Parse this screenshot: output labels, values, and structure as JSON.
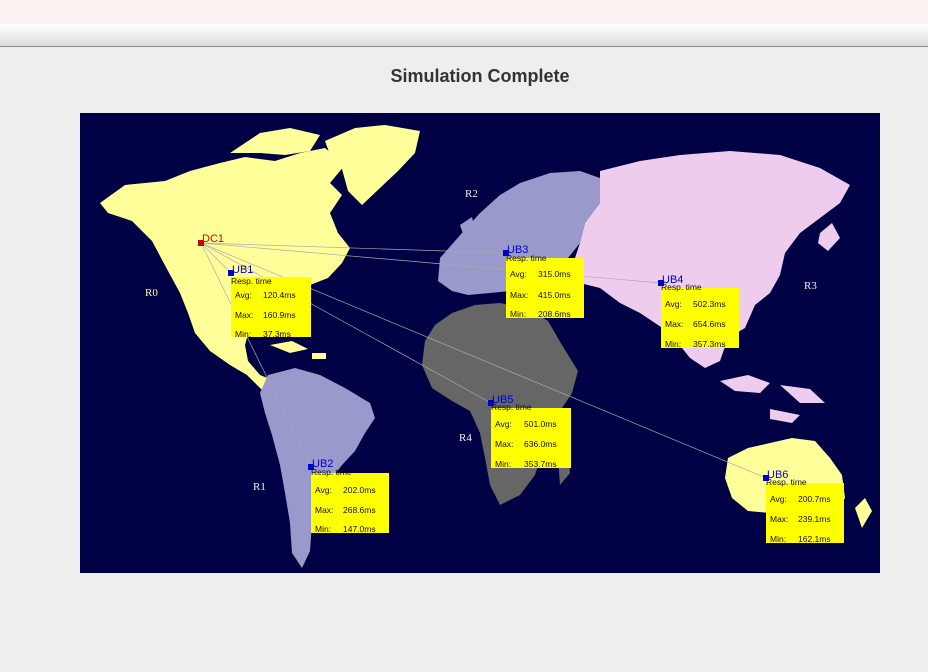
{
  "header": {
    "title": "Simulation Complete"
  },
  "colors": {
    "ocean": "#000044",
    "north_america": "#ffff99",
    "south_america": "#9999cc",
    "europe": "#9999cc",
    "asia": "#eeccee",
    "africa": "#666666",
    "australia": "#ffff99",
    "greenland": "#ffff99",
    "stats_box": "#ffff00",
    "ub_label": "#0000cc",
    "dc_label": "#cc0000"
  },
  "regions": [
    {
      "label": "R0",
      "color": "#ffff99"
    },
    {
      "label": "R1",
      "color": "#eeeeee"
    },
    {
      "label": "R2",
      "color": "#eeeeee"
    },
    {
      "label": "R3",
      "color": "#eeeeee"
    },
    {
      "label": "R4",
      "color": "#eeeeee"
    }
  ],
  "datacenter": {
    "label": "DC1"
  },
  "userbases": [
    {
      "label": "UB1",
      "resp": "Resp. time",
      "avg_label": "Avg:",
      "avg": "120.4ms",
      "max_label": "Max:",
      "max": "160.9ms",
      "min_label": "Min:",
      "min": "37.3ms"
    },
    {
      "label": "UB2",
      "resp": "Resp. time",
      "avg_label": "Avg:",
      "avg": "202.0ms",
      "max_label": "Max:",
      "max": "268.6ms",
      "min_label": "Min:",
      "min": "147.0ms"
    },
    {
      "label": "UB3",
      "resp": "Resp. time",
      "avg_label": "Avg:",
      "avg": "315.0ms",
      "max_label": "Max:",
      "max": "415.0ms",
      "min_label": "Min:",
      "min": "208.6ms"
    },
    {
      "label": "UB4",
      "resp": "Resp. time",
      "avg_label": "Avg:",
      "avg": "502.3ms",
      "max_label": "Max:",
      "max": "654.6ms",
      "min_label": "Min:",
      "min": "357.3ms"
    },
    {
      "label": "UB5",
      "resp": "Resp. time",
      "avg_label": "Avg:",
      "avg": "501.0ms",
      "max_label": "Max:",
      "max": "636.0ms",
      "min_label": "Min:",
      "min": "353.7ms"
    },
    {
      "label": "UB6",
      "resp": "Resp. time",
      "avg_label": "Avg:",
      "avg": "200.7ms",
      "max_label": "Max:",
      "max": "239.1ms",
      "min_label": "Min:",
      "min": "162.1ms"
    }
  ]
}
